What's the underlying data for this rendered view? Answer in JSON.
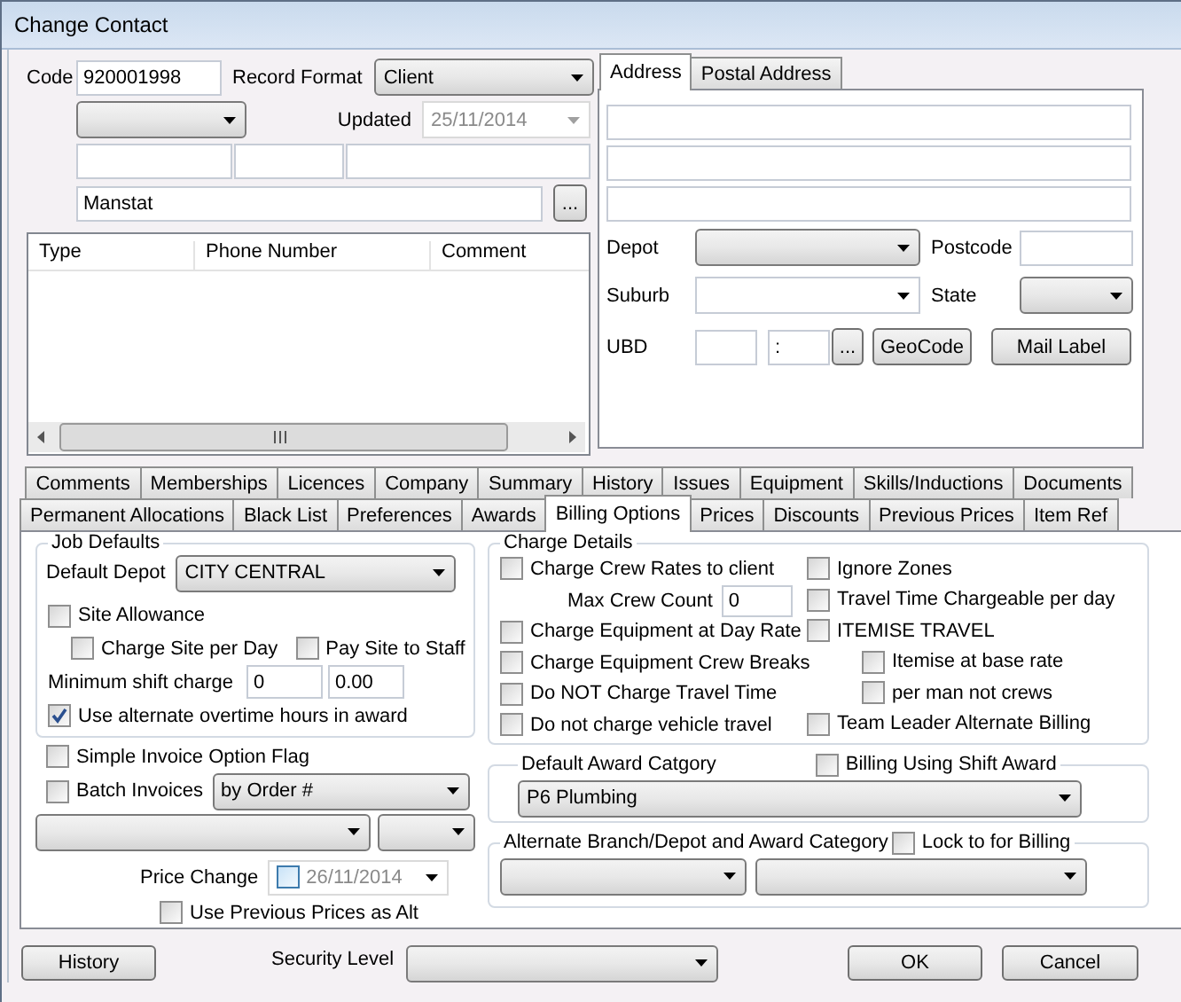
{
  "window": {
    "title": "Change Contact"
  },
  "contact": {
    "code_label": "Code",
    "code": "920001998",
    "record_format_label": "Record Format",
    "record_format": "Client",
    "updated_label": "Updated",
    "updated": {
      "value": "25/11/2014",
      "disabled": true
    },
    "name": "Manstat",
    "browse_button": "..."
  },
  "phones": {
    "columns": [
      "Type",
      "Phone Number",
      "Comment"
    ]
  },
  "address": {
    "tabs": [
      {
        "label": "Address",
        "selected": true
      },
      {
        "label": "Postal Address",
        "selected": false
      }
    ],
    "depot_label": "Depot",
    "postcode_label": "Postcode",
    "suburb_label": "Suburb",
    "state_label": "State",
    "ubd_label": "UBD",
    "ubd_value": ":",
    "browse_button": "...",
    "geocode_button": "GeoCode",
    "mail_label_button": "Mail Label"
  },
  "tab_rows": [
    {
      "tabs": [
        {
          "label": "Comments",
          "selected": false
        },
        {
          "label": "Memberships",
          "selected": false
        },
        {
          "label": "Licences",
          "selected": false
        },
        {
          "label": "Company",
          "selected": false
        },
        {
          "label": "Summary",
          "selected": false
        },
        {
          "label": "History",
          "selected": false
        },
        {
          "label": "Issues",
          "selected": false
        },
        {
          "label": "Equipment",
          "selected": false
        },
        {
          "label": "Skills/Inductions",
          "selected": false
        },
        {
          "label": "Documents",
          "selected": false
        }
      ]
    },
    {
      "tabs": [
        {
          "label": "Permanent Allocations",
          "selected": false
        },
        {
          "label": "Black List",
          "selected": false
        },
        {
          "label": "Preferences",
          "selected": false
        },
        {
          "label": "Awards",
          "selected": false
        },
        {
          "label": "Billing Options",
          "selected": true
        },
        {
          "label": "Prices",
          "selected": false
        },
        {
          "label": "Discounts",
          "selected": false
        },
        {
          "label": "Previous Prices",
          "selected": false
        },
        {
          "label": "Item Ref",
          "selected": false
        }
      ]
    }
  ],
  "billing": {
    "job_defaults": {
      "title": "Job Defaults",
      "default_depot_label": "Default Depot",
      "default_depot": "CITY CENTRAL",
      "site_allowance": {
        "label": "Site Allowance",
        "checked": false
      },
      "charge_site_per_day": {
        "label": "Charge Site per Day",
        "checked": false
      },
      "pay_site_to_staff": {
        "label": "Pay Site to Staff",
        "checked": false
      },
      "minimum_shift_label": "Minimum shift charge",
      "minimum_shift_1": "0",
      "minimum_shift_2": "0.00",
      "alternate_overtime": {
        "label": "Use alternate overtime hours in award",
        "checked": true
      }
    },
    "simple_invoice": {
      "label": "Simple Invoice Option Flag",
      "checked": false
    },
    "batch_invoices": {
      "label": "Batch Invoices",
      "checked": false
    },
    "batch_by": "by Order #",
    "price_change_label": "Price Change",
    "price_change": {
      "checked": false,
      "date": "26/11/2014"
    },
    "use_previous_prices": {
      "label": "Use Previous Prices as Alt",
      "checked": false
    },
    "charge_details": {
      "title": "Charge Details",
      "left": [
        {
          "kind": "check",
          "label": "Charge Crew Rates to client",
          "checked": false
        },
        {
          "kind": "field",
          "label": "Max Crew Count",
          "value": "0"
        },
        {
          "kind": "check",
          "label": "Charge Equipment at Day Rate",
          "checked": false
        },
        {
          "kind": "check",
          "label": "Charge Equipment Crew Breaks",
          "checked": false
        },
        {
          "kind": "check",
          "label": "Do NOT Charge Travel Time",
          "checked": false
        },
        {
          "kind": "check",
          "label": "Do not charge vehicle travel",
          "checked": false
        }
      ],
      "right": [
        {
          "kind": "check",
          "label": "Ignore Zones",
          "checked": false
        },
        {
          "kind": "check",
          "label": "Travel Time Chargeable per day",
          "checked": false
        },
        {
          "kind": "check",
          "label": "ITEMISE TRAVEL",
          "checked": false
        },
        {
          "kind": "subcheck",
          "label": "Itemise at base rate",
          "checked": false
        },
        {
          "kind": "subcheck",
          "label": "per man not crews",
          "checked": false
        },
        {
          "kind": "check",
          "label": "Team Leader Alternate Billing",
          "checked": false
        }
      ]
    },
    "award": {
      "title": "Default Award Catgory",
      "shift_award": {
        "label": "Billing Using Shift Award",
        "checked": false
      },
      "category": "P6 Plumbing"
    },
    "alternate": {
      "title": "Alternate Branch/Depot and Award Category",
      "lock": {
        "label": "Lock to for Billing",
        "checked": false
      }
    }
  },
  "footer": {
    "history_button": "History",
    "security_label": "Security Level",
    "ok_button": "OK",
    "cancel_button": "Cancel"
  }
}
